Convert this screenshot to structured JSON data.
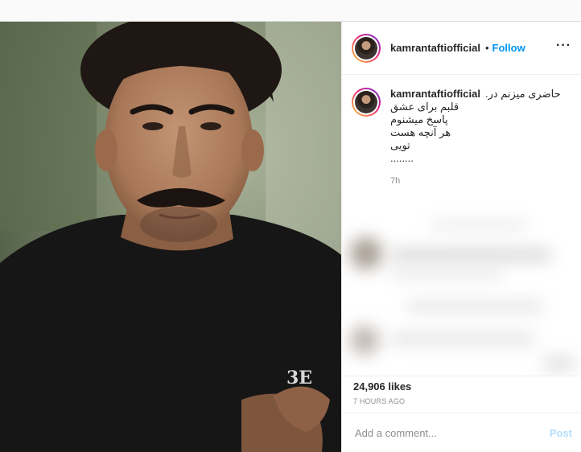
{
  "post": {
    "author": {
      "username": "kamrantaftiofficial",
      "follow_label": "Follow",
      "separator": "•"
    },
    "more_icon": "more-options-icon",
    "caption": {
      "username": "kamrantaftiofficial",
      "lines": [
        "حاضری میزنم در.",
        "قلبم برای عشق",
        "پاسخ میشنوم",
        "هر آنچه هست",
        "تویی",
        "........"
      ],
      "time": "7h"
    },
    "likes": "24,906 likes",
    "posted_ago": "7 HOURS AGO",
    "comment": {
      "placeholder": "Add a comment...",
      "post_label": "Post"
    },
    "colors": {
      "accent": "#0095f6",
      "post_disabled": "#b2dffc",
      "muted": "#8e8e8e"
    }
  }
}
